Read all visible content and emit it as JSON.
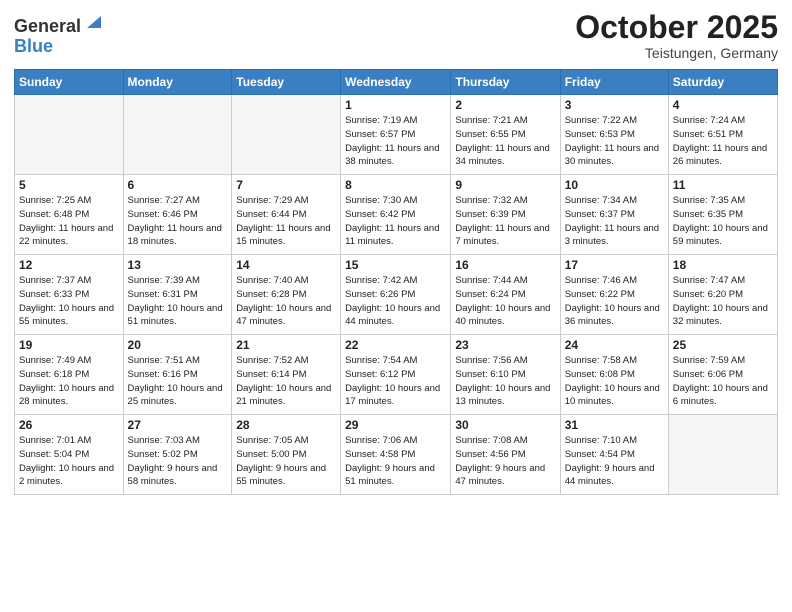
{
  "header": {
    "logo_general": "General",
    "logo_blue": "Blue",
    "month": "October 2025",
    "location": "Teistungen, Germany"
  },
  "weekdays": [
    "Sunday",
    "Monday",
    "Tuesday",
    "Wednesday",
    "Thursday",
    "Friday",
    "Saturday"
  ],
  "weeks": [
    [
      {
        "day": "",
        "info": ""
      },
      {
        "day": "",
        "info": ""
      },
      {
        "day": "",
        "info": ""
      },
      {
        "day": "1",
        "info": "Sunrise: 7:19 AM\nSunset: 6:57 PM\nDaylight: 11 hours\nand 38 minutes."
      },
      {
        "day": "2",
        "info": "Sunrise: 7:21 AM\nSunset: 6:55 PM\nDaylight: 11 hours\nand 34 minutes."
      },
      {
        "day": "3",
        "info": "Sunrise: 7:22 AM\nSunset: 6:53 PM\nDaylight: 11 hours\nand 30 minutes."
      },
      {
        "day": "4",
        "info": "Sunrise: 7:24 AM\nSunset: 6:51 PM\nDaylight: 11 hours\nand 26 minutes."
      }
    ],
    [
      {
        "day": "5",
        "info": "Sunrise: 7:25 AM\nSunset: 6:48 PM\nDaylight: 11 hours\nand 22 minutes."
      },
      {
        "day": "6",
        "info": "Sunrise: 7:27 AM\nSunset: 6:46 PM\nDaylight: 11 hours\nand 18 minutes."
      },
      {
        "day": "7",
        "info": "Sunrise: 7:29 AM\nSunset: 6:44 PM\nDaylight: 11 hours\nand 15 minutes."
      },
      {
        "day": "8",
        "info": "Sunrise: 7:30 AM\nSunset: 6:42 PM\nDaylight: 11 hours\nand 11 minutes."
      },
      {
        "day": "9",
        "info": "Sunrise: 7:32 AM\nSunset: 6:39 PM\nDaylight: 11 hours\nand 7 minutes."
      },
      {
        "day": "10",
        "info": "Sunrise: 7:34 AM\nSunset: 6:37 PM\nDaylight: 11 hours\nand 3 minutes."
      },
      {
        "day": "11",
        "info": "Sunrise: 7:35 AM\nSunset: 6:35 PM\nDaylight: 10 hours\nand 59 minutes."
      }
    ],
    [
      {
        "day": "12",
        "info": "Sunrise: 7:37 AM\nSunset: 6:33 PM\nDaylight: 10 hours\nand 55 minutes."
      },
      {
        "day": "13",
        "info": "Sunrise: 7:39 AM\nSunset: 6:31 PM\nDaylight: 10 hours\nand 51 minutes."
      },
      {
        "day": "14",
        "info": "Sunrise: 7:40 AM\nSunset: 6:28 PM\nDaylight: 10 hours\nand 47 minutes."
      },
      {
        "day": "15",
        "info": "Sunrise: 7:42 AM\nSunset: 6:26 PM\nDaylight: 10 hours\nand 44 minutes."
      },
      {
        "day": "16",
        "info": "Sunrise: 7:44 AM\nSunset: 6:24 PM\nDaylight: 10 hours\nand 40 minutes."
      },
      {
        "day": "17",
        "info": "Sunrise: 7:46 AM\nSunset: 6:22 PM\nDaylight: 10 hours\nand 36 minutes."
      },
      {
        "day": "18",
        "info": "Sunrise: 7:47 AM\nSunset: 6:20 PM\nDaylight: 10 hours\nand 32 minutes."
      }
    ],
    [
      {
        "day": "19",
        "info": "Sunrise: 7:49 AM\nSunset: 6:18 PM\nDaylight: 10 hours\nand 28 minutes."
      },
      {
        "day": "20",
        "info": "Sunrise: 7:51 AM\nSunset: 6:16 PM\nDaylight: 10 hours\nand 25 minutes."
      },
      {
        "day": "21",
        "info": "Sunrise: 7:52 AM\nSunset: 6:14 PM\nDaylight: 10 hours\nand 21 minutes."
      },
      {
        "day": "22",
        "info": "Sunrise: 7:54 AM\nSunset: 6:12 PM\nDaylight: 10 hours\nand 17 minutes."
      },
      {
        "day": "23",
        "info": "Sunrise: 7:56 AM\nSunset: 6:10 PM\nDaylight: 10 hours\nand 13 minutes."
      },
      {
        "day": "24",
        "info": "Sunrise: 7:58 AM\nSunset: 6:08 PM\nDaylight: 10 hours\nand 10 minutes."
      },
      {
        "day": "25",
        "info": "Sunrise: 7:59 AM\nSunset: 6:06 PM\nDaylight: 10 hours\nand 6 minutes."
      }
    ],
    [
      {
        "day": "26",
        "info": "Sunrise: 7:01 AM\nSunset: 5:04 PM\nDaylight: 10 hours\nand 2 minutes."
      },
      {
        "day": "27",
        "info": "Sunrise: 7:03 AM\nSunset: 5:02 PM\nDaylight: 9 hours\nand 58 minutes."
      },
      {
        "day": "28",
        "info": "Sunrise: 7:05 AM\nSunset: 5:00 PM\nDaylight: 9 hours\nand 55 minutes."
      },
      {
        "day": "29",
        "info": "Sunrise: 7:06 AM\nSunset: 4:58 PM\nDaylight: 9 hours\nand 51 minutes."
      },
      {
        "day": "30",
        "info": "Sunrise: 7:08 AM\nSunset: 4:56 PM\nDaylight: 9 hours\nand 47 minutes."
      },
      {
        "day": "31",
        "info": "Sunrise: 7:10 AM\nSunset: 4:54 PM\nDaylight: 9 hours\nand 44 minutes."
      },
      {
        "day": "",
        "info": ""
      }
    ]
  ]
}
